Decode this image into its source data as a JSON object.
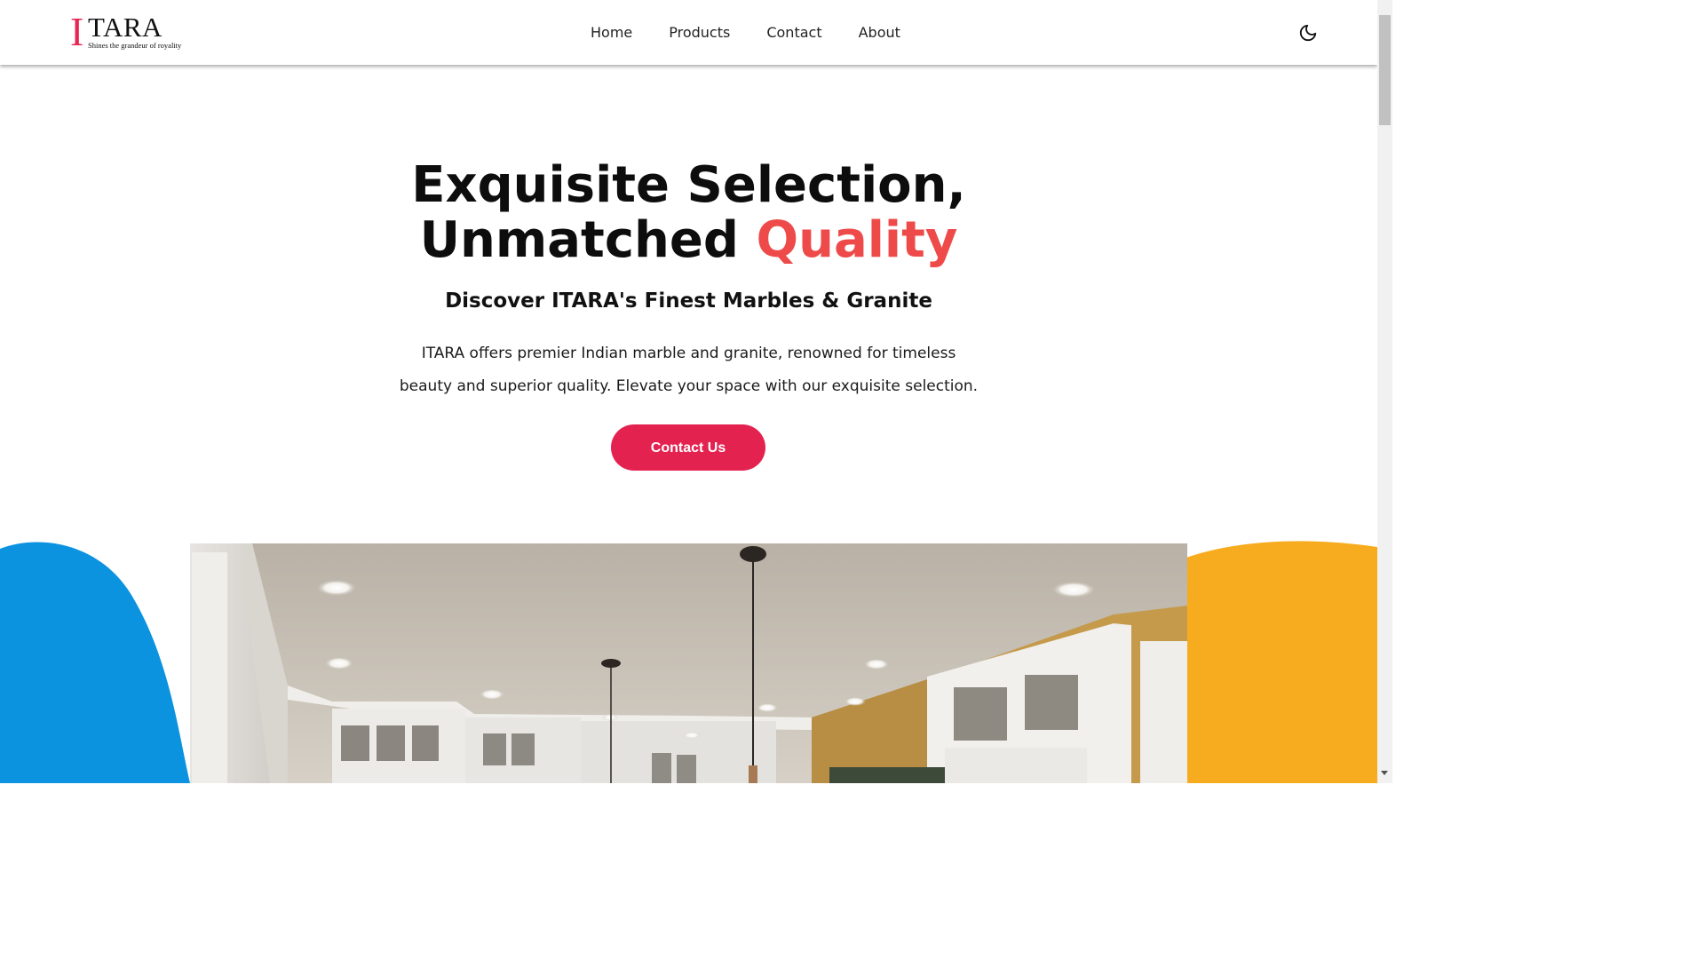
{
  "header": {
    "logo": {
      "letter": "I",
      "rest": "TARA",
      "tagline": "Shines the grandeur of royality"
    },
    "nav": [
      {
        "label": "Home"
      },
      {
        "label": "Products"
      },
      {
        "label": "Contact"
      },
      {
        "label": "About"
      }
    ],
    "theme_toggle_icon": "moon-icon"
  },
  "hero": {
    "title_line1": "Exquisite Selection,",
    "title_line2_part1": "Unmatched",
    "title_line2_accent": "Quality",
    "subtitle": "Discover ITARA's Finest Marbles & Granite",
    "description": "ITARA offers premier Indian marble and granite, renowned for timeless beauty and superior quality. Elevate your space with our exquisite selection.",
    "cta_label": "Contact Us"
  },
  "colors": {
    "accent_text": "#ee4a4a",
    "cta_background": "#e3224f",
    "blob_left": "#0b93e0",
    "blob_right": "#f7ab1e"
  }
}
